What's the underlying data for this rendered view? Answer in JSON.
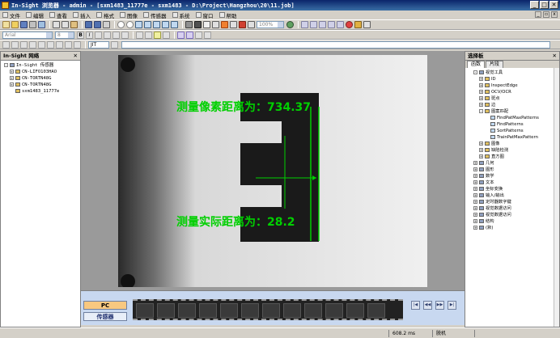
{
  "window": {
    "title": "In-Sight 浏览器 - admin - [sxm1483_11777e - sxm1483 - D:\\Project\\Hangzhou\\20\\11.job]",
    "minimize": "_",
    "maximize": "□",
    "close": "✕"
  },
  "menu": [
    "文件",
    "编辑",
    "查看",
    "插入",
    "格式",
    "图像",
    "传感器",
    "系统",
    "窗口",
    "帮助"
  ],
  "toolbar": {
    "font_combo": "Arial",
    "size_combo": "8",
    "zoom_combo": "100%",
    "edit_value": "JIT"
  },
  "network_panel": {
    "title": "In-Sight 网络",
    "items": [
      {
        "label": "In-Sight 传感器",
        "indent": 0,
        "expander": "-"
      },
      {
        "label": "CN-LIFO103HAO",
        "indent": 1,
        "expander": "+"
      },
      {
        "label": "CN-TORTN48G",
        "indent": 1,
        "expander": "+"
      },
      {
        "label": "CN-TORTN48G",
        "indent": 1,
        "expander": "+"
      },
      {
        "label": "sxm1483_11777e",
        "indent": 1,
        "expander": ""
      }
    ]
  },
  "image": {
    "pixel_distance_label": "测量像素距离为：734.37",
    "real_distance_label": "测量实际距离为：28.2"
  },
  "filmstrip": {
    "pc_button": "PC",
    "sensor_button": "传感器",
    "nav": [
      "|◀",
      "◀◀",
      "▶▶",
      "▶|"
    ]
  },
  "palette": {
    "title": "选择板",
    "tabs": [
      "函数",
      "片段"
    ],
    "tree": [
      {
        "label": "视觉工具",
        "indent": 0,
        "expander": "-"
      },
      {
        "label": "ID",
        "indent": 1,
        "expander": "+"
      },
      {
        "label": "InspectEdge",
        "indent": 1,
        "expander": "+"
      },
      {
        "label": "OCV/OCR",
        "indent": 1,
        "expander": "+"
      },
      {
        "label": "斑点",
        "indent": 1,
        "expander": "+"
      },
      {
        "label": "边",
        "indent": 1,
        "expander": "+"
      },
      {
        "label": "图案匹配",
        "indent": 1,
        "expander": "-"
      },
      {
        "label": "FindPatMaxPatterns",
        "indent": 2,
        "expander": ""
      },
      {
        "label": "FindPatterns",
        "indent": 2,
        "expander": ""
      },
      {
        "label": "SortPatterns",
        "indent": 2,
        "expander": ""
      },
      {
        "label": "TrainPatMaxPattern",
        "indent": 2,
        "expander": ""
      },
      {
        "label": "图像",
        "indent": 1,
        "expander": "+"
      },
      {
        "label": "缺陷检测",
        "indent": 1,
        "expander": "+"
      },
      {
        "label": "直方图",
        "indent": 1,
        "expander": "+"
      },
      {
        "label": "几何",
        "indent": 0,
        "expander": "+"
      },
      {
        "label": "图形",
        "indent": 0,
        "expander": "+"
      },
      {
        "label": "数学",
        "indent": 0,
        "expander": "+"
      },
      {
        "label": "文本",
        "indent": 0,
        "expander": "+"
      },
      {
        "label": "坐标变换",
        "indent": 0,
        "expander": "+"
      },
      {
        "label": "输入/输出",
        "indent": 0,
        "expander": "+"
      },
      {
        "label": "定时器数字键",
        "indent": 0,
        "expander": "+"
      },
      {
        "label": "视觉数据访问",
        "indent": 0,
        "expander": "+"
      },
      {
        "label": "视觉数据访问",
        "indent": 0,
        "expander": "+"
      },
      {
        "label": "结构",
        "indent": 0,
        "expander": "+"
      },
      {
        "label": "(默)",
        "indent": 0,
        "expander": "+"
      }
    ]
  },
  "status": {
    "coords": "608.2 ms",
    "mode": "脱机"
  },
  "colors": {
    "overlay_green": "#00d000",
    "title_blue": "#0a246a"
  }
}
